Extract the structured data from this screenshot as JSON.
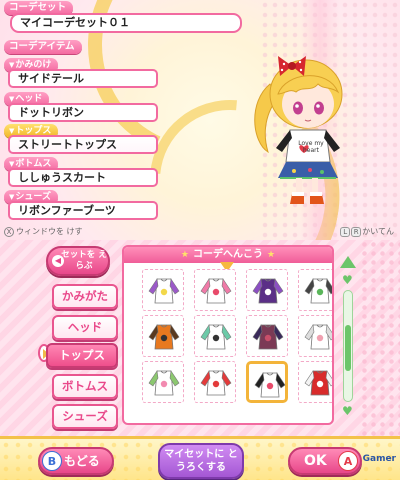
{
  "top": {
    "set_label": "コーデセット",
    "set_name": "マイコーデセット０１",
    "items_label": "コーデアイテム",
    "items": [
      {
        "category": "かみのけ",
        "value": "サイドテール"
      },
      {
        "category": "ヘッド",
        "value": "ドットリボン"
      },
      {
        "category": "トップス",
        "value": "ストリートトップス"
      },
      {
        "category": "ボトムス",
        "value": "ししゅうスカート"
      },
      {
        "category": "シューズ",
        "value": "リボンファーブーツ"
      }
    ],
    "footer_left_key": "X",
    "footer_left": "ウィンドウを けす",
    "footer_right_keys": [
      "L",
      "R"
    ],
    "footer_right": "かいてん",
    "shirt_text": "Love my heart"
  },
  "bottom": {
    "set_pick_button": "セットを えらぶ",
    "tabs": [
      "かみがた",
      "ヘッド",
      "トップス",
      "ボトムス",
      "シューズ"
    ],
    "active_tab": "トップス",
    "grid_title": "コーデへんこう",
    "back_key": "B",
    "back_label": "もどる",
    "register_label": "マイセットに とうろくする",
    "ok_label": "OK",
    "ok_key": "A",
    "watermark": "Gamer"
  },
  "colors": {
    "accent": "#f26aa0",
    "gold": "#f3c24a",
    "scroll": "#6cc56a"
  },
  "grid_items": [
    {
      "name": "purple-yellow-top",
      "body": "#ffffff",
      "sleeve": "#9b59c9",
      "accent": "#f2d84a"
    },
    {
      "name": "heart-tee",
      "body": "#ffffff",
      "sleeve": "#f07aa8",
      "accent": "#e84a6a"
    },
    {
      "name": "dark-purple-top",
      "body": "#5b2f87",
      "sleeve": "#8b4fc2",
      "accent": "#ffffff"
    },
    {
      "name": "green-floral-top",
      "body": "#ffffff",
      "sleeve": "#444444",
      "accent": "#5ab65a"
    },
    {
      "name": "pumpkin-top",
      "body": "#e8791f",
      "sleeve": "#5a3a20",
      "accent": "#333333"
    },
    {
      "name": "mint-wing-top",
      "body": "#ffffff",
      "sleeve": "#6ccaa8",
      "accent": "#333333"
    },
    {
      "name": "plaid-top",
      "body": "#7b3a55",
      "sleeve": "#3a2a5a",
      "accent": "#c94f6a"
    },
    {
      "name": "white-ruffle-top",
      "body": "#ffffff",
      "sleeve": "#dddddd",
      "accent": "#f0a0b0"
    },
    {
      "name": "green-bow-top",
      "body": "#ffffff",
      "sleeve": "#8cc870",
      "accent": "#f28ab0"
    },
    {
      "name": "red-white-top",
      "body": "#ffffff",
      "sleeve": "#e33b3b",
      "accent": "#e33b3b"
    },
    {
      "name": "street-top-selected",
      "body": "#ffffff",
      "sleeve": "#222222",
      "accent": "#e84a6a"
    },
    {
      "name": "red-jacket-top",
      "body": "#d82b2b",
      "sleeve": "#f3f3f3",
      "accent": "#ffffff"
    }
  ]
}
